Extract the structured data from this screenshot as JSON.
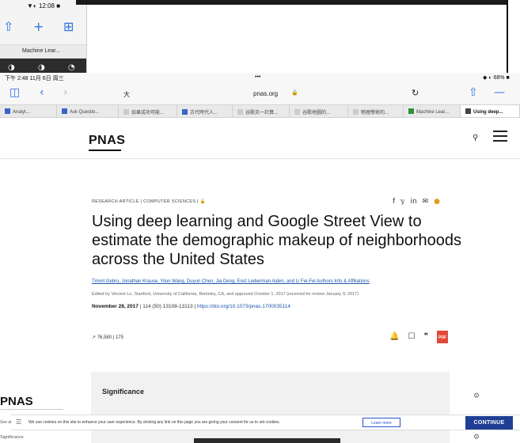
{
  "bg_window": {
    "status": "▼◐ 12:08 ■",
    "tab_label": "Machine Lear...",
    "dark_icons": [
      "◑",
      "◑",
      "◔"
    ]
  },
  "status_bar": {
    "left": "下午 2:48  11月 6日 周三",
    "center": "•••",
    "right": "◆ ◐ 68% ■"
  },
  "toolbar": {
    "reader": "大",
    "url": "pnas.org",
    "lock": "🔒"
  },
  "tabs": [
    {
      "label": "Analyt..."
    },
    {
      "label": "Ask Questio..."
    },
    {
      "label": "如果成功可能..."
    },
    {
      "label": "古代時代人..."
    },
    {
      "label": "谷歌另一計算..."
    },
    {
      "label": "谷歌地圖的..."
    },
    {
      "label": "物理學術的..."
    },
    {
      "label": "Machine Lear..."
    },
    {
      "label": "Using deep..."
    }
  ],
  "site": {
    "logo": "PNAS"
  },
  "article": {
    "category": "RESEARCH ARTICLE  |  COMPUTER SCIENCES  |",
    "title": "Using deep learning and Google Street View to estimate the demographic makeup of neighborhoods across the United States",
    "authors": "Timnit Gebru, Jonathan Krause, Yilun Wang, Duyun Chen, Jia Deng, Erez Lieberman Aiden, and Li Fei-Fei   Authors Info & Affiliations",
    "edited": "Edited by Vincent Lo, Stanford, University of California, Berkeley, CA, and approved October 1, 2017 (received for review January 9, 2017)",
    "date": "November 28, 2017",
    "volume": "114 (50) 13108-13113",
    "doi": "https://doi.org/10.1073/pnas.1700035114",
    "metrics": "76,580  |  175",
    "pdf": "PDF",
    "significance": "Significance"
  },
  "bl_window": {
    "logo": "PNAS",
    "line1": "Significance",
    "line2": "See all"
  },
  "cookie": {
    "text": "We use cookies on this site to enhance your user experience. By clicking any link on this page you are giving your consent for us to set cookies.",
    "link": "Learn more",
    "button": "CONTINUE"
  }
}
